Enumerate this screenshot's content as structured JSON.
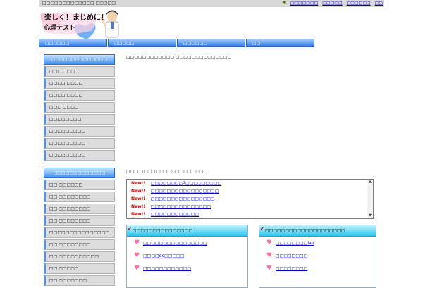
{
  "header": {
    "description": "□□□□□□□□□□□□□ □□□□□",
    "links": [
      "□□□□□□□",
      "□□□□□",
      "□□□□□□",
      "□□"
    ]
  },
  "logo": {
    "line1": "楽しく！まじめに！",
    "line2": "心理テスト"
  },
  "nav": {
    "tabs": [
      "□□□□□□",
      "□□□□□",
      "□□□□□□",
      "□□"
    ]
  },
  "sidebar": {
    "section1": {
      "title": "□□□□□□□□□□□□□□",
      "items": [
        "□□□ □□□□",
        "□□□□ □□□□",
        "□□□□ □□□□",
        "□□□ □□□□",
        "□□□□□□□□",
        "□□□□□□□□□",
        "□□□□□□□□□",
        "□□□□□□□□□"
      ]
    },
    "section2": {
      "title": "□□□□□□□□□□□□□",
      "items": [
        "□□ □□□□□□",
        "□□ □□□□□□□□",
        "□□ □□□□□□□□",
        "□□ □□□□□□□□",
        "□□□□□□□□□□□□□□□",
        "□□ □□□□□□□□",
        "□□ □□□□□□□□□□",
        "□□ □□□□□",
        "□□ □□□□□□□"
      ]
    }
  },
  "main": {
    "breadcrumb": "□□□□□□□□□□□□ □□□□□□□□□□□□□□",
    "news_title": "□□□ □□□□□□□□□□□□□□□□□",
    "news": [
      {
        "badge": "New!!",
        "text": "□□□□□□□□2□□□□□□□□□"
      },
      {
        "badge": "New!!",
        "text": "□□□□□□□□□□□□□□□□□"
      },
      {
        "badge": "New!!",
        "text": "□□□□□□□□□□□□□□□□"
      },
      {
        "badge": "New!!",
        "text": "□□□□□□□□□□□□□□□"
      },
      {
        "badge": "New!!",
        "text": "□□□□□□□□□□□□"
      }
    ],
    "box1": {
      "title": "□□□□□□□□□□□□□□□",
      "items": [
        "□□□□□□□□□□□□□□□□",
        "□□□□de□□□□□",
        "□□□□□□□□□□□□"
      ]
    },
    "box2": {
      "title": "□□□□□□□□□□□□□□□□□□□□",
      "items": [
        "□□□□□□□□lair",
        "□□□□□□□□",
        "□□□□□□□□"
      ]
    }
  },
  "colors": {
    "nav": "#2f79e6",
    "box_head": "#2cc6ee",
    "heart": "#ff6fa6",
    "link": "#0000cc",
    "new_badge": "#cc0000"
  }
}
